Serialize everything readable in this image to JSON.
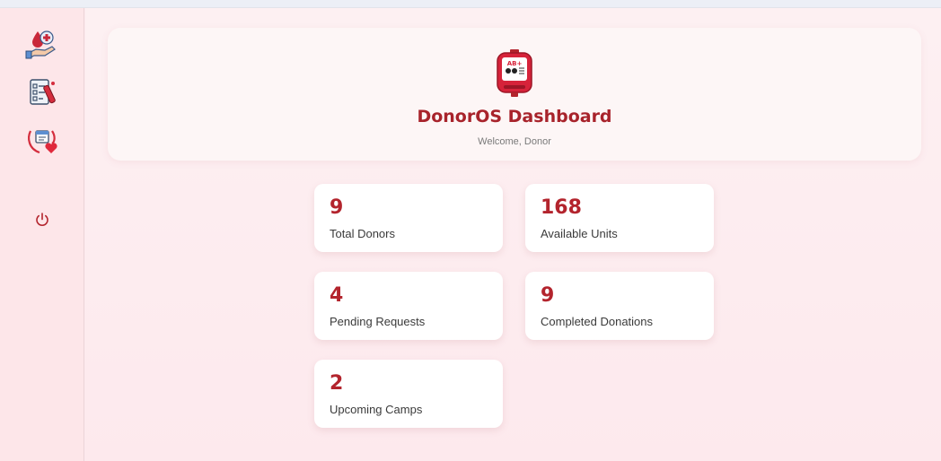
{
  "header": {
    "title": "DonorOS Dashboard",
    "subtitle": "Welcome, Donor",
    "logo_icon": "blood-bag-icon",
    "logo_badge": "AB+"
  },
  "sidebar": {
    "items": [
      {
        "icon": "blood-donation-hand-icon"
      },
      {
        "icon": "blood-test-checklist-icon"
      },
      {
        "icon": "donation-calendar-heart-icon"
      },
      {
        "icon": "power-icon"
      }
    ]
  },
  "stats": [
    {
      "value": "9",
      "label": "Total Donors"
    },
    {
      "value": "168",
      "label": "Available Units"
    },
    {
      "value": "4",
      "label": "Pending Requests"
    },
    {
      "value": "9",
      "label": "Completed Donations"
    },
    {
      "value": "2",
      "label": "Upcoming Camps"
    }
  ],
  "colors": {
    "accent": "#b3242d",
    "title": "#a8232b",
    "background": "#fdeaee",
    "sidebar": "#fde6e9",
    "card": "#ffffff"
  }
}
